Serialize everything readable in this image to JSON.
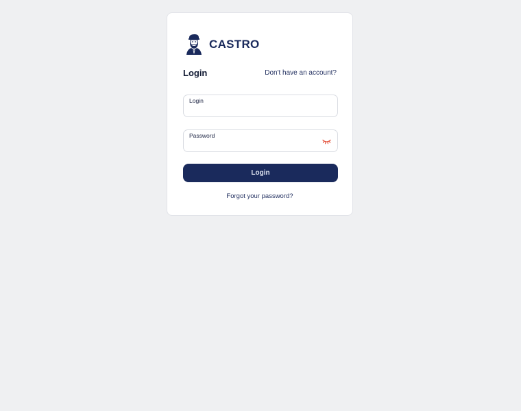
{
  "brand": {
    "name": "CASTRO",
    "logo_icon": "bearded-man-logo-icon",
    "color": "#1a2a5c"
  },
  "form": {
    "title": "Login",
    "signup_link": "Don't have an account?",
    "login_field": {
      "label": "Login",
      "value": ""
    },
    "password_field": {
      "label": "Password",
      "value": "",
      "toggle_icon": "eye-closed-icon",
      "toggle_color": "#e4553f"
    },
    "submit_label": "Login",
    "forgot_link": "Forgot your password?"
  },
  "colors": {
    "background": "#eff0f2",
    "card": "#ffffff",
    "primary": "#1a2a5c"
  }
}
